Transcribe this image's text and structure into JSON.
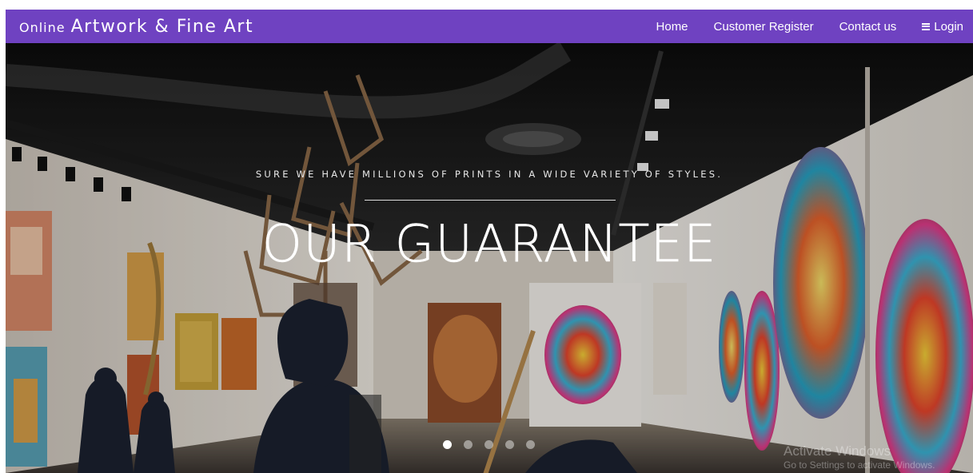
{
  "navbar": {
    "brand_prefix": "Online",
    "brand_name": "Artwork & Fine Art",
    "links": [
      {
        "label": "Home"
      },
      {
        "label": "Customer Register"
      },
      {
        "label": "Contact us"
      }
    ],
    "login": {
      "label": "Login",
      "icon": "bars-icon"
    },
    "color": "#6f42c1"
  },
  "hero": {
    "subtitle": "SURE WE HAVE MILLIONS OF PRINTS IN A WIDE VARIETY OF STYLES.",
    "title": "OUR GUARANTEE",
    "carousel": {
      "slide_count": 5,
      "active_index": 0
    }
  },
  "watermark": {
    "line1": "Activate Windows",
    "line2": "Go to Settings to activate Windows."
  }
}
